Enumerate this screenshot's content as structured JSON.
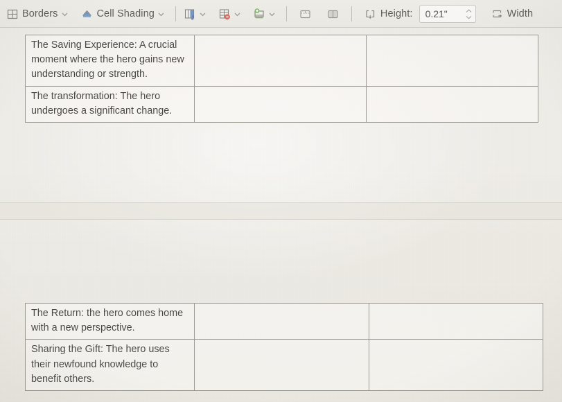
{
  "toolbar": {
    "borders": {
      "label": "Borders",
      "icon": "borders-icon",
      "caret": "chevron-down-icon"
    },
    "cell_shading": {
      "label": "Cell Shading",
      "icon": "paint-bucket-icon",
      "caret": "chevron-down-icon"
    },
    "insert_column": {
      "icon": "insert-column-icon",
      "caret": "chevron-down-icon"
    },
    "delete_rows": {
      "icon": "delete-row-icon",
      "caret": "chevron-down-icon"
    },
    "insert_cells": {
      "icon": "insert-cells-icon",
      "caret": "chevron-down-icon"
    },
    "merge_cells": {
      "icon": "merge-cells-icon"
    },
    "split_cells": {
      "icon": "split-cells-icon"
    },
    "height": {
      "icon": "row-height-icon",
      "label": "Height:",
      "value": "0.21\"",
      "spinner_up": "spinner-up-icon",
      "spinner_down": "spinner-down-icon"
    },
    "width": {
      "icon": "column-width-icon",
      "label": "Width"
    }
  },
  "document": {
    "tables": [
      {
        "id": "table-one",
        "rows": [
          {
            "cells": [
              "The Saving Experience: A crucial moment where the hero gains new understanding or strength.",
              "",
              ""
            ]
          },
          {
            "cells": [
              "The transformation: The hero undergoes a significant change.",
              "",
              ""
            ]
          }
        ]
      },
      {
        "id": "table-two",
        "rows": [
          {
            "cells": [
              "The Return: the hero comes home with a new perspective.",
              "",
              ""
            ]
          },
          {
            "cells": [
              "Sharing the Gift: The hero uses their newfound knowledge to benefit others.",
              "",
              ""
            ]
          }
        ]
      }
    ]
  },
  "colors": {
    "paper": "#eeece7",
    "toolbar": "#eae8e2",
    "table_border": "#9b9a92",
    "text": "#4a4945",
    "label_text": "#5d5c58",
    "accent_blue": "#3f73b8",
    "accent_red": "#d9534f",
    "accent_green": "#6aa84f"
  }
}
